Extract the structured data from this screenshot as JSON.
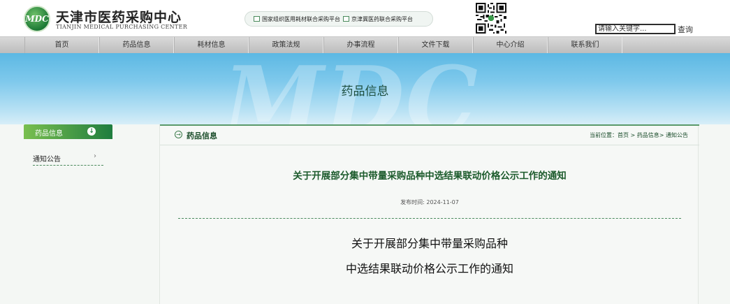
{
  "header": {
    "logo_mark": "MDC",
    "logo_cn": "天津市医药采购中心",
    "logo_en": "TIANJIN MEDICAL PURCHASING CENTER",
    "platform_links": [
      "国家组织医用耗材联合采购平台",
      "京津冀医药联合采购平台"
    ],
    "search_placeholder": "请输入关键字...",
    "search_button": "查询"
  },
  "nav": {
    "items": [
      "首页",
      "药品信息",
      "耗材信息",
      "政策法规",
      "办事流程",
      "文件下载",
      "中心介绍",
      "联系我们"
    ]
  },
  "banner": {
    "watermark": "MDC",
    "title": "药品信息"
  },
  "sidebar": {
    "heading": "药品信息",
    "heading_icon": "↓",
    "items": [
      {
        "label": "通知公告",
        "arrow": "›"
      }
    ]
  },
  "main": {
    "section_title": "药品信息",
    "breadcrumb": "当前位置：首页 > 药品信息> 通知公告",
    "article_title": "关于开展部分集中带量采购品种中选结果联动价格公示工作的通知",
    "publish_time": "发布时间: 2024-11-07",
    "body_title_line1": "关于开展部分集中带量采购品种",
    "body_title_line2": "中选结果联动价格公示工作的通知"
  },
  "colors": {
    "brand_green": "#1f7d3f",
    "nav_gray": "#c9c9c9",
    "banner_blue": "#6ec2ea",
    "title_green": "#1b5a2b"
  },
  "icons": {
    "sidebar_heading": "down-arrow-circle-icon",
    "section_heading": "right-arrow-circle-icon",
    "platform_link": "square-icon",
    "qr": "qr-code-icon"
  }
}
